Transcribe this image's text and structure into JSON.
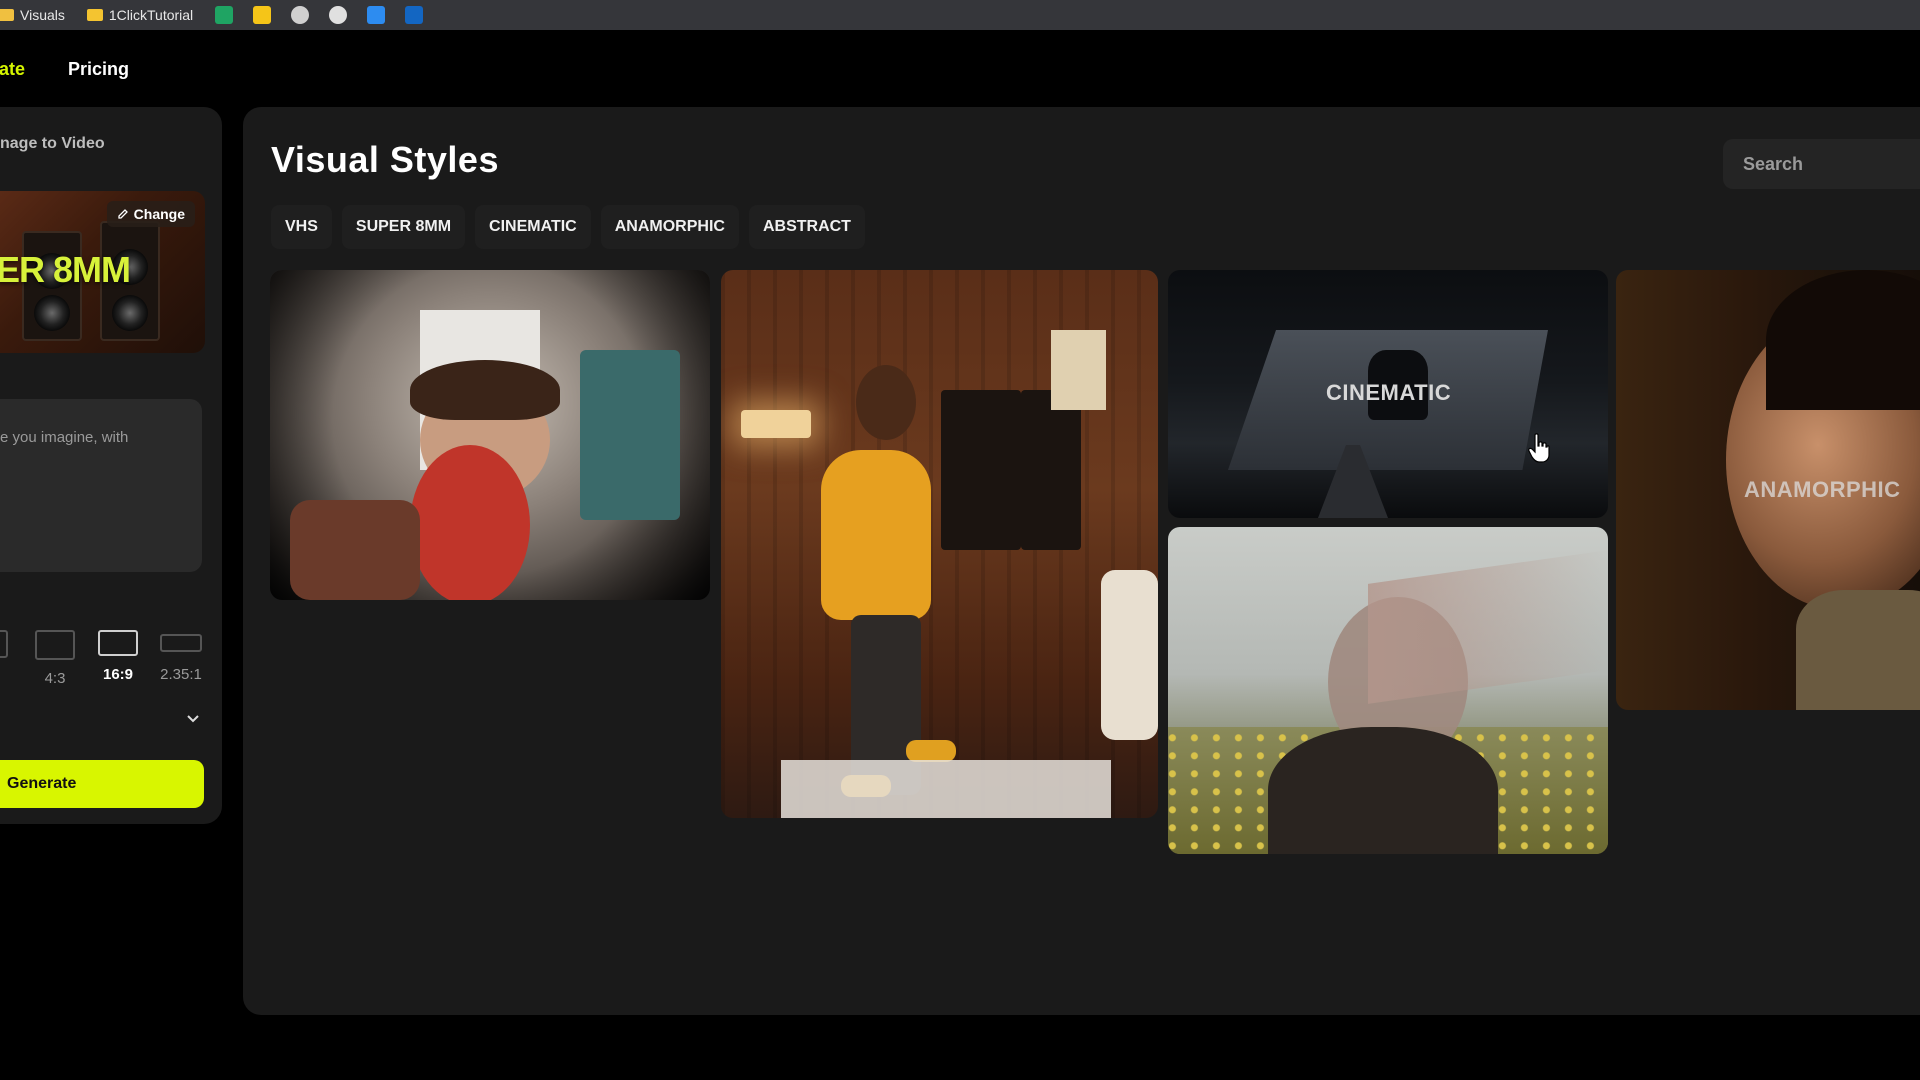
{
  "bookmarks": {
    "items": [
      {
        "label": "Visuals"
      },
      {
        "label": "1ClickTutorial"
      }
    ],
    "icons": [
      "sheets-icon",
      "notes-icon",
      "target-icon",
      "chatgpt-icon",
      "grammarly-icon",
      "outlook-icon"
    ]
  },
  "nav": {
    "active_label": "ate",
    "pricing_label": "Pricing"
  },
  "left_panel": {
    "title": "nage to Video",
    "thumbnail_text": "ER 8MM",
    "change_label": "Change",
    "prompt_placeholder": "e you imagine, with",
    "aspect_ratios": [
      {
        "label": ""
      },
      {
        "label": "4:3"
      },
      {
        "label": "16:9",
        "selected": true
      },
      {
        "label": "2.35:1"
      }
    ],
    "generate_label": "Generate"
  },
  "main": {
    "title": "Visual Styles",
    "search_placeholder": "Search",
    "tabs": [
      {
        "label": "VHS"
      },
      {
        "label": "SUPER 8MM"
      },
      {
        "label": "CINEMATIC"
      },
      {
        "label": "ANAMORPHIC"
      },
      {
        "label": "ABSTRACT"
      }
    ],
    "cards": [
      {
        "style": "VHS",
        "label": ""
      },
      {
        "style": "SUPER 8MM",
        "label": ""
      },
      {
        "style": "CINEMATIC",
        "label": "CINEMATIC"
      },
      {
        "style": "ABSTRACT",
        "label": ""
      },
      {
        "style": "ANAMORPHIC",
        "label": "ANAMORPHIC"
      }
    ]
  },
  "colors": {
    "accent": "#d8f600",
    "panel_bg": "#1a1a1a",
    "page_bg": "#000000"
  }
}
